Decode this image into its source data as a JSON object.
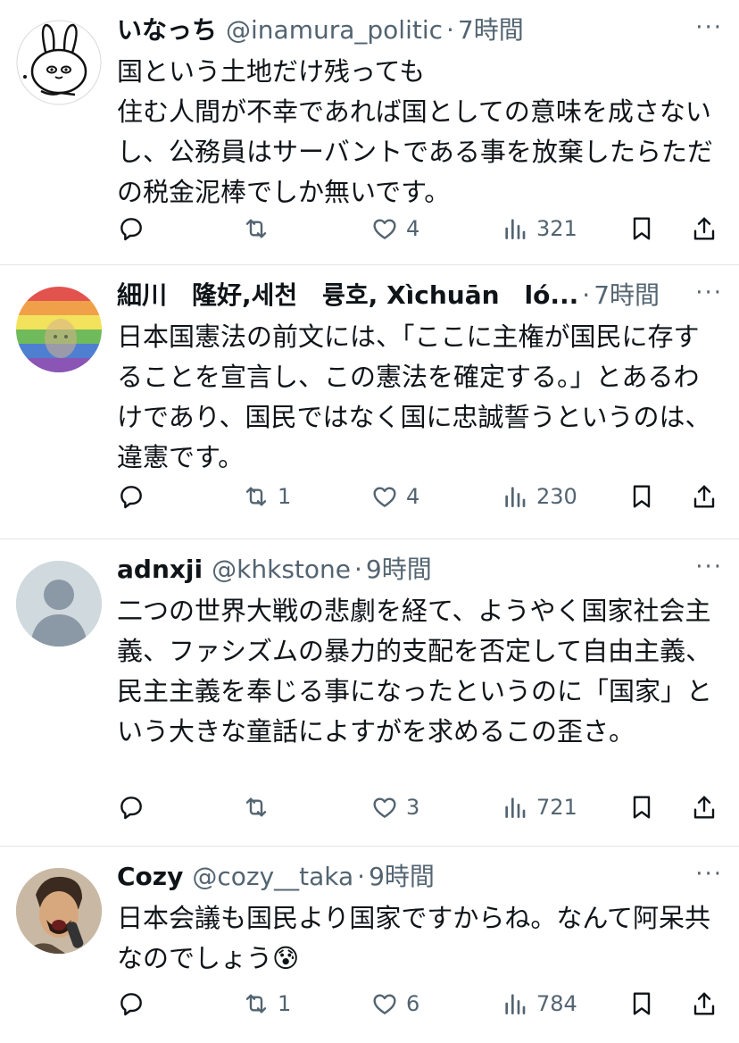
{
  "tweets": [
    {
      "name": "いなっち",
      "handle": "@inamura_politic",
      "sep": "·",
      "time": "7時間",
      "more": "···",
      "text": "国という土地だけ残っても\n住む人間が不幸であれば国としての意味を成さないし、公務員はサーバントである事を放棄したらただの税金泥棒でしか無いです。",
      "replies": "",
      "retweets": "",
      "likes": "4",
      "views": "321",
      "avatar_icon": "rabbit-cartoon-avatar"
    },
    {
      "name": "細川　隆好,세천　륭호, Xìchuān　ló...",
      "handle": "",
      "sep": "·",
      "time": "7時間",
      "more": "···",
      "text": "日本国憲法の前文には、「ここに主権が国民に存することを宣言し、この憲法を確定する。」とあるわけであり、国民ではなく国に忠誠誓うというのは、違憲です。",
      "replies": "",
      "retweets": "1",
      "likes": "4",
      "views": "230",
      "avatar_icon": "rainbow-photo-avatar"
    },
    {
      "name": "adnxji",
      "handle": "@khkstone",
      "sep": "·",
      "time": "9時間",
      "more": "···",
      "text": "二つの世界大戦の悲劇を経て、ようやく国家社会主義、ファシズムの暴力的支配を否定して自由主義、民主主義を奉じる事になったというのに「国家」という大きな童話によすがを求めるこの歪さ。",
      "replies": "",
      "retweets": "",
      "likes": "3",
      "views": "721",
      "avatar_icon": "default-person-avatar"
    },
    {
      "name": "Cozy",
      "handle": "@cozy__taka",
      "sep": "·",
      "time": "9時間",
      "more": "···",
      "text": "日本会議も国民より国家ですからね。なんて阿呆共なのでしょう😰",
      "replies": "",
      "retweets": "1",
      "likes": "6",
      "views": "784",
      "avatar_icon": "singer-photo-avatar"
    }
  ],
  "colors": {
    "text": "#0f1419",
    "secondary": "#536471",
    "divider": "#e3e6e9"
  },
  "icons": [
    "reply-icon",
    "retweet-icon",
    "like-icon",
    "views-icon",
    "bookmark-icon",
    "share-icon",
    "more-icon"
  ]
}
